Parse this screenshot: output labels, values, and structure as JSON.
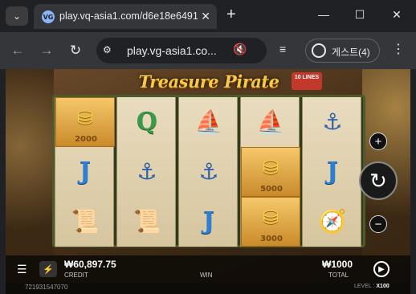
{
  "browser": {
    "tab_title": "play.vq-asia1.com/d6e18e6491",
    "favicon": "VG",
    "url": "play.vg-asia1.co...",
    "profile_label": "게스트(4)"
  },
  "game": {
    "logo": "Treasure Pirate",
    "lines_badge": "10 LINES",
    "reels": [
      [
        {
          "symbol": "coins",
          "value": "2000"
        },
        {
          "symbol": "J"
        },
        {
          "symbol": "scroll"
        }
      ],
      [
        {
          "symbol": "Q"
        },
        {
          "symbol": "anchor"
        },
        {
          "symbol": "scroll"
        }
      ],
      [
        {
          "symbol": "ship"
        },
        {
          "symbol": "anchor"
        },
        {
          "symbol": "J"
        }
      ],
      [
        {
          "symbol": "ship"
        },
        {
          "symbol": "coins",
          "value": "5000"
        },
        {
          "symbol": "coins",
          "value": "3000"
        }
      ],
      [
        {
          "symbol": "anchor"
        },
        {
          "symbol": "J"
        },
        {
          "symbol": "compass"
        }
      ]
    ],
    "credit_value": "₩60,897.75",
    "credit_label": "CREDIT",
    "win_label": "WIN",
    "total_value": "₩1000",
    "total_label": "TOTAL",
    "session_id": "721931547070",
    "level_label": "LEVEL :",
    "level_value": "X100"
  }
}
